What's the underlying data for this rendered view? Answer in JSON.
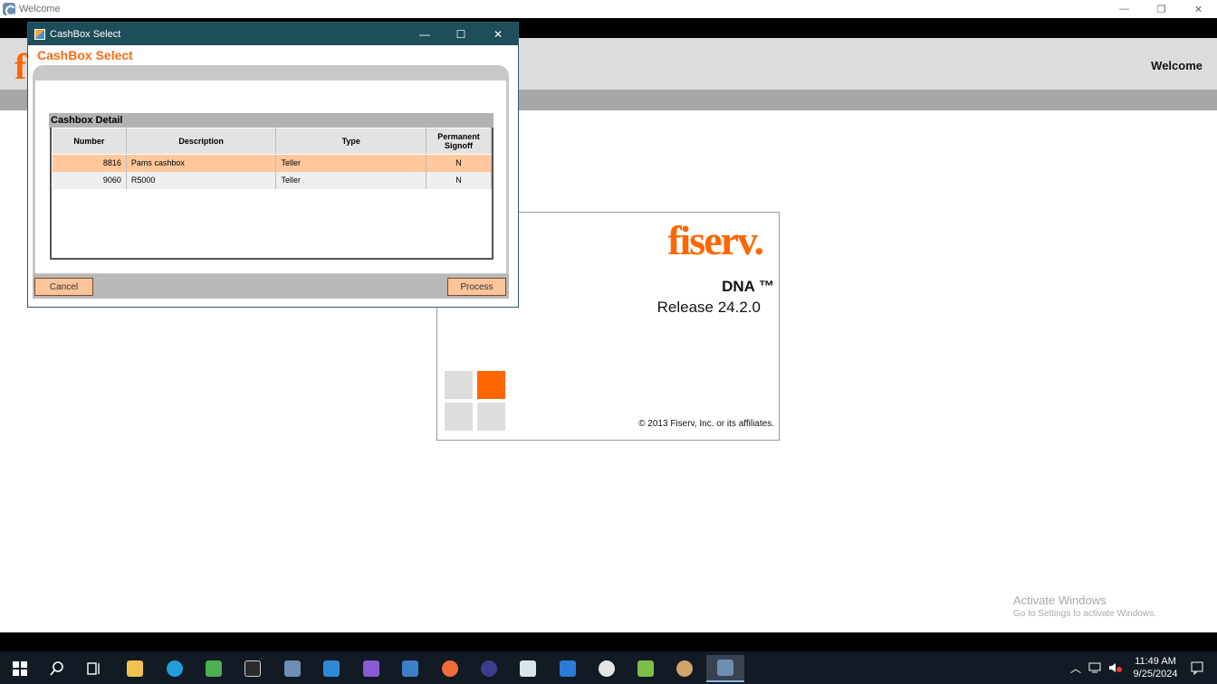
{
  "main_window": {
    "title": "Welcome",
    "welcome_label": "Welcome",
    "controls": {
      "minimize": "—",
      "restore": "❐",
      "close": "✕"
    }
  },
  "splash": {
    "brand": "fiserv.",
    "product": "DNA ™",
    "release": "Release 24.2.0",
    "copyright": "© 2013 Fiserv, Inc. or its affiliates.",
    "colors": {
      "orange": "#ff6600",
      "gray": "#dddddd"
    }
  },
  "dialog": {
    "title": "CashBox Select",
    "heading": "CashBox Select",
    "controls": {
      "minimize": "—",
      "maximize": "☐",
      "close": "✕"
    },
    "section_title": "Cashbox Detail",
    "columns": [
      "Number",
      "Description",
      "Type",
      "Permanent Signoff"
    ],
    "rows": [
      {
        "number": "8816",
        "description": "Pams cashbox",
        "type": "Teller",
        "signoff": "N",
        "selected": true
      },
      {
        "number": "9060",
        "description": "R5000",
        "type": "Teller",
        "signoff": "N",
        "selected": false
      }
    ],
    "cancel_label": "Cancel",
    "process_label": "Process"
  },
  "activation": {
    "line1": "Activate Windows",
    "line2": "Go to Settings to activate Windows."
  },
  "taskbar": {
    "apps": [
      "start-icon",
      "search-icon",
      "task-view-icon",
      "file-explorer-icon",
      "edge-icon",
      "media-app-icon",
      "terminal-icon",
      "dna-app-icon",
      "vscode-icon",
      "visual-studio-icon",
      "document-app-icon",
      "postman-icon",
      "eclipse-icon",
      "app-window-icon",
      "app-window-blue-icon",
      "paint-icon",
      "chart-app-icon",
      "palette-app-icon",
      "dna-active-icon"
    ],
    "time": "11:49 AM",
    "date": "9/25/2024"
  }
}
